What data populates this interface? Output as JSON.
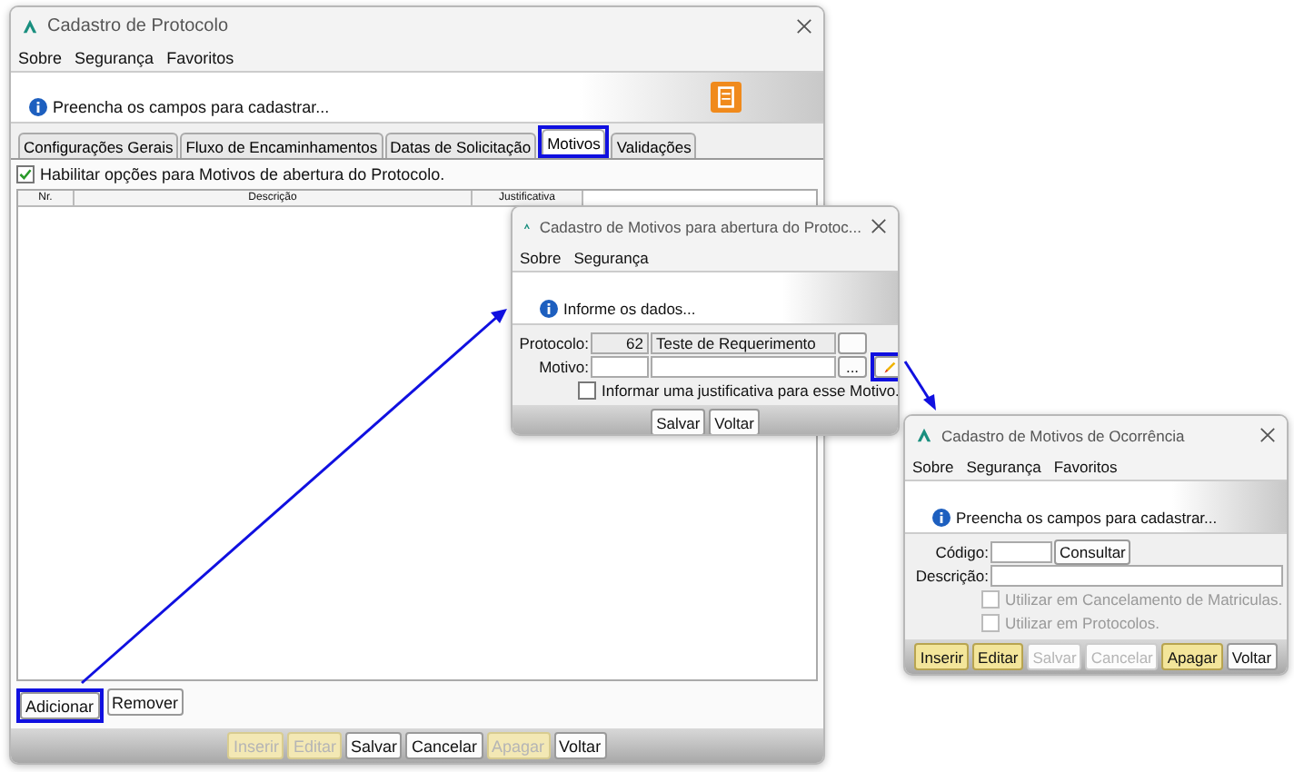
{
  "main_window": {
    "title": "Cadastro de Protocolo",
    "menu": [
      "Sobre",
      "Segurança",
      "Favoritos"
    ],
    "info_message": "Preencha os campos para cadastrar...",
    "tabs": [
      {
        "label": "Configurações Gerais",
        "selected": false
      },
      {
        "label": "Fluxo de Encaminhamentos",
        "selected": false
      },
      {
        "label": "Datas de Solicitação",
        "selected": false
      },
      {
        "label": "Motivos",
        "selected": true
      },
      {
        "label": "Validações",
        "selected": false
      }
    ],
    "enable_checkbox": {
      "label": "Habilitar opções para Motivos de abertura do Protocolo.",
      "checked": true
    },
    "table": {
      "columns": [
        "Nr.",
        "Descrição",
        "Justificativa"
      ]
    },
    "list_buttons": [
      "Adicionar",
      "Remover"
    ],
    "action_buttons": [
      {
        "label": "Inserir",
        "kind": "accent",
        "disabled": true
      },
      {
        "label": "Editar",
        "kind": "accent",
        "disabled": true
      },
      {
        "label": "Salvar",
        "kind": "plain",
        "disabled": false
      },
      {
        "label": "Cancelar",
        "kind": "plain",
        "disabled": false
      },
      {
        "label": "Apagar",
        "kind": "accent",
        "disabled": true
      },
      {
        "label": "Voltar",
        "kind": "plain",
        "disabled": false
      }
    ]
  },
  "motivo_dialog": {
    "title": "Cadastro de Motivos para abertura do Protoc...",
    "menu": [
      "Sobre",
      "Segurança"
    ],
    "info_message": "Informe os dados...",
    "protocolo": {
      "label": "Protocolo:",
      "code": "62",
      "name": "Teste de Requerimento"
    },
    "motivo": {
      "label": "Motivo:",
      "lookup": "..."
    },
    "justify_checkbox": {
      "label": "Informar uma justificativa para esse Motivo.",
      "checked": false
    },
    "buttons": [
      {
        "label": "Salvar",
        "kind": "plain",
        "disabled": false
      },
      {
        "label": "Voltar",
        "kind": "plain",
        "disabled": false
      }
    ]
  },
  "ocorrencia_dialog": {
    "title": "Cadastro de Motivos de Ocorrência",
    "menu": [
      "Sobre",
      "Segurança",
      "Favoritos"
    ],
    "info_message": "Preencha os campos para cadastrar...",
    "codigo_label": "Código:",
    "consult_button": "Consultar",
    "descricao_label": "Descrição:",
    "checkboxes": [
      {
        "label": "Utilizar em Cancelamento de Matriculas.",
        "checked": false,
        "disabled": true
      },
      {
        "label": "Utilizar em Protocolos.",
        "checked": false,
        "disabled": true
      }
    ],
    "buttons": [
      {
        "label": "Inserir",
        "kind": "accent",
        "disabled": false
      },
      {
        "label": "Editar",
        "kind": "accent",
        "disabled": false
      },
      {
        "label": "Salvar",
        "kind": "plain",
        "disabled": true
      },
      {
        "label": "Cancelar",
        "kind": "plain",
        "disabled": true
      },
      {
        "label": "Apagar",
        "kind": "accent",
        "disabled": false
      },
      {
        "label": "Voltar",
        "kind": "plain",
        "disabled": false
      }
    ]
  }
}
